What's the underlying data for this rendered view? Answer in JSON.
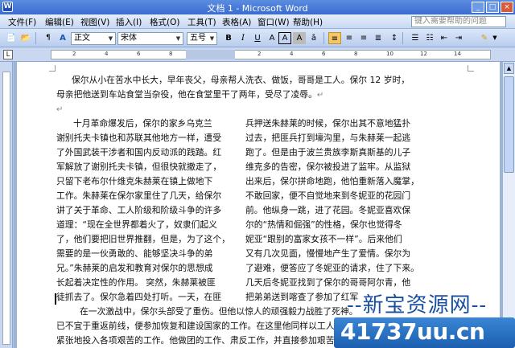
{
  "window": {
    "title": "文档 1 - Microsoft Word"
  },
  "menu": {
    "items": [
      "文件(F)",
      "编辑(E)",
      "视图(V)",
      "插入(I)",
      "格式(O)",
      "工具(T)",
      "表格(A)",
      "窗口(W)",
      "帮助(H)"
    ],
    "help_placeholder": "键入需要帮助的问题"
  },
  "toolbar": {
    "style": "正文",
    "font": "宋体",
    "size": "五号",
    "bold": "B",
    "italic": "I",
    "underline": "U",
    "char_border": "A",
    "char_shading": "A"
  },
  "document": {
    "intro": [
      "保尔从小在苦水中长大，早年丧父，母亲帮人洗衣、做饭，哥哥是工人。保尔 12 岁时，",
      "母亲把他送到车站食堂当杂役，他在食堂里干了两年，受尽了凌辱。"
    ],
    "col1": [
      "十月革命爆发后，保尔的家乡乌克兰",
      "谢别托夫卡镇也和苏联其他地方一样，遭受",
      "了外国武装干涉者和国内反动派的践踏。红",
      "军解放了谢别托夫卡镇，但很快就撤走了，",
      "只留下老布尔什维克朱赫莱在镇上做地下",
      "工作。朱赫莱在保尔家里住了几天，给保尔",
      "讲了关于革命、工人阶级和阶级斗争的许多",
      "道理：“现在全世界都着火了，奴隶们起义",
      "了，他们要把旧世界推翻，但是，为了这个，",
      "需要的是一伙勇敢的、能够坚决斗争的弟",
      "兄。”朱赫莱的启发和教育对保尔的思想成",
      "长起着决定性的作用。 突然，朱赫莱被匪",
      "徒抓去了。保尔急着四处打听。一天，在匪"
    ],
    "col2": [
      "兵押送朱赫莱的时候，保尔出其不意地猛扑",
      "过去，把匪兵打到壕沟里，与朱赫莱一起逃",
      "跑了。但是由于波兰贵族李斯真斯基的儿子",
      "维克多的告密，保尔被投进了监牢。从监狱",
      "出来后，保尔拼命地跑，他怕重新落入魔掌，",
      "不敢回家，便不自觉地来到冬妮亚的花园门",
      "前。他纵身一跳，进了花园。冬妮亚喜欢保",
      "尔的“热情和倔强”的性格，保尔也觉得冬",
      "妮亚“跟别的富家女孩不一样”。后来他们",
      "又有几次见面，慢慢地产生了爱情。保尔为",
      "了避难，便答应了冬妮亚的请求，住了下来。",
      "几天后冬妮亚找到了保尔的哥哥阿尔青，他",
      "把弟弟送到喀查了参加了红军"
    ],
    "tail": [
      "在一次激战中，保尔头部受了重伤。但他以惊人的顽强毅力战胜了死神。",
      "已不宜于重返前线，便参加恢复和建设国家的工作。在这里他同样以工人队",
      "紧张地投入各项艰苦的工作。他做团的工作、肃反工作，并直接参加艰苦"
    ]
  },
  "watermark": {
    "top": "--新宝资源网--",
    "bottom": "41737uu.cn"
  }
}
